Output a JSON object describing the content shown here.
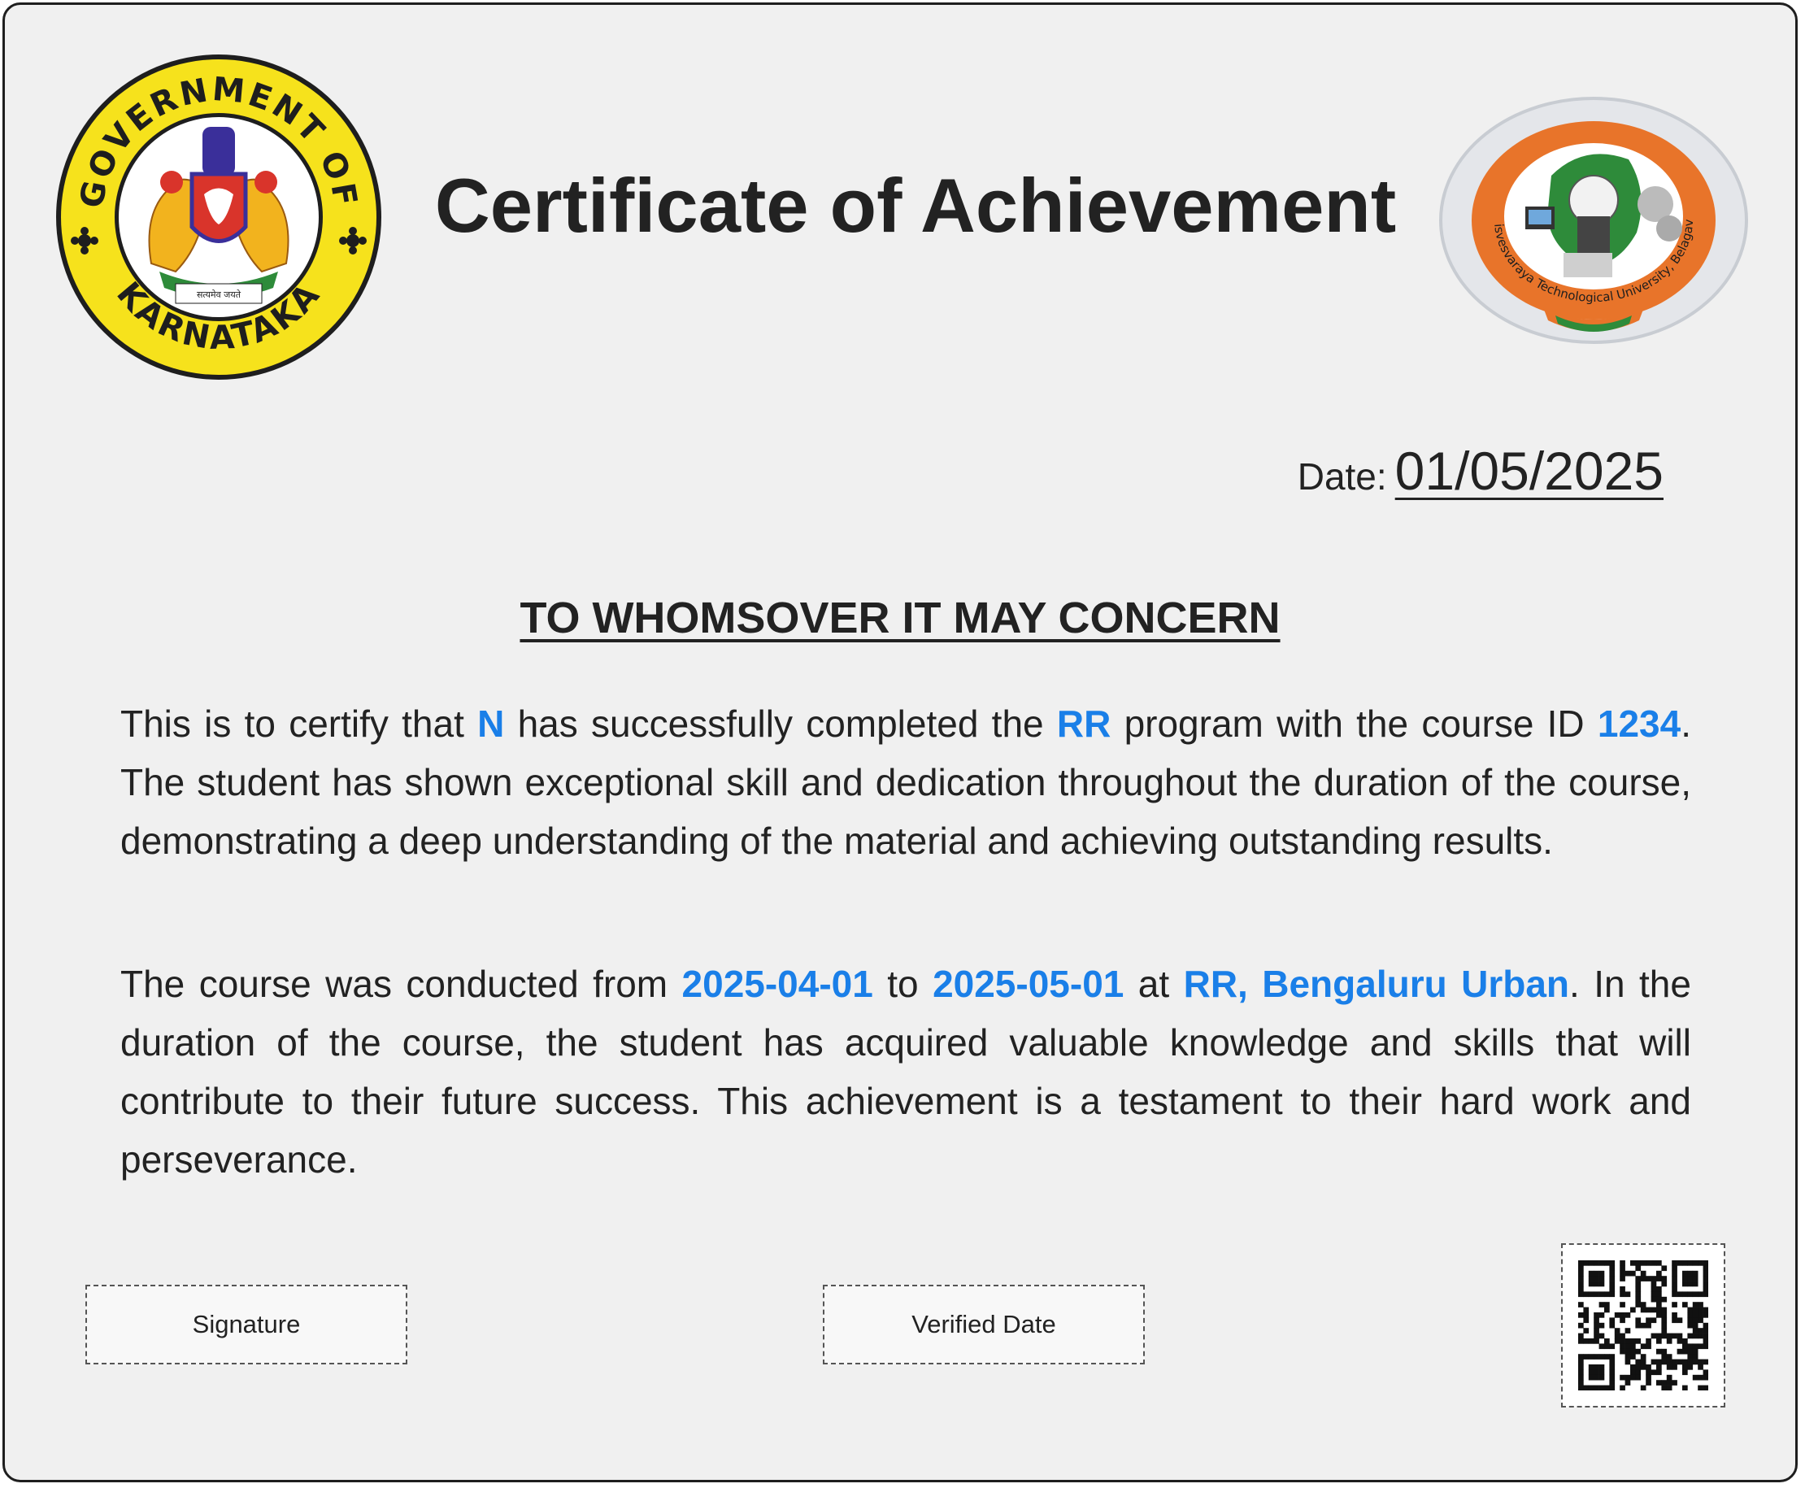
{
  "certificate": {
    "title": "Certificate of Achievement",
    "date_label": "Date:",
    "date_value": "01/05/2025",
    "heading": "TO WHOMSOVER IT MAY CONCERN",
    "paragraph1": {
      "t1": "This is to certify that ",
      "student_name": "N",
      "t2": " has successfully completed the ",
      "program": "RR",
      "t3": " program with the course ID ",
      "course_id": "1234",
      "t4": ". The student has shown exceptional skill and dedication throughout the duration of the course, demonstrating a deep understanding of the material and achieving outstanding results."
    },
    "paragraph2": {
      "t1": "The course was conducted from ",
      "start_date": "2025-04-01",
      "t2": " to ",
      "end_date": "2025-05-01",
      "t3": " at ",
      "location": "RR, Bengaluru Urban",
      "t4": ". In the duration of the course, the student has acquired valuable knowledge and skills that will contribute to their future success. This achievement is a testament to their hard work and perseverance."
    },
    "signature_label": "Signature",
    "verified_date_label": "Verified Date"
  },
  "logos": {
    "left_seal_top_text": "GOVERNMENT OF",
    "left_seal_bottom_text": "KARNATAKA",
    "left_seal_motto": "सत्यमेव जयते",
    "right_seal_text": "Visvesvaraya Technological University, Belagavi"
  },
  "colors": {
    "accent": "#1a7fe8",
    "seal_yellow": "#f6e21c",
    "seal_orange": "#e8742a",
    "seal_green": "#2e8b3a"
  },
  "icons": {
    "left_logo": "karnataka-government-seal-icon",
    "right_logo": "vtu-seal-icon",
    "qr": "qr-code-icon"
  }
}
